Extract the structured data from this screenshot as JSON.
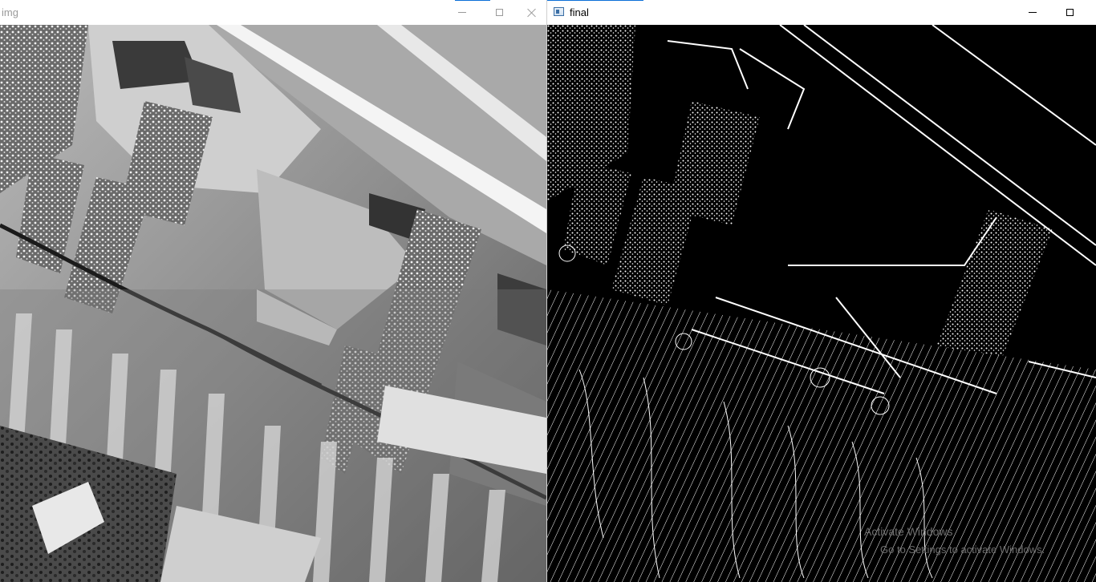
{
  "windows": {
    "img": {
      "title": "img",
      "controls": [
        "minimize",
        "maximize",
        "close"
      ]
    },
    "final": {
      "title": "final",
      "controls": [
        "minimize",
        "maximize"
      ]
    }
  },
  "watermark": {
    "line1": "Activate Windows",
    "line2": "Go to Settings to activate Windows."
  },
  "colors": {
    "titlebar": "#ffffff",
    "edge_background": "#000000",
    "edge_foreground": "#ffffff",
    "accent": "#0b6fd8"
  },
  "icons": {
    "minimize": "minimize-icon",
    "maximize": "maximize-icon",
    "close": "close-icon",
    "app": "opencv-window-icon"
  }
}
